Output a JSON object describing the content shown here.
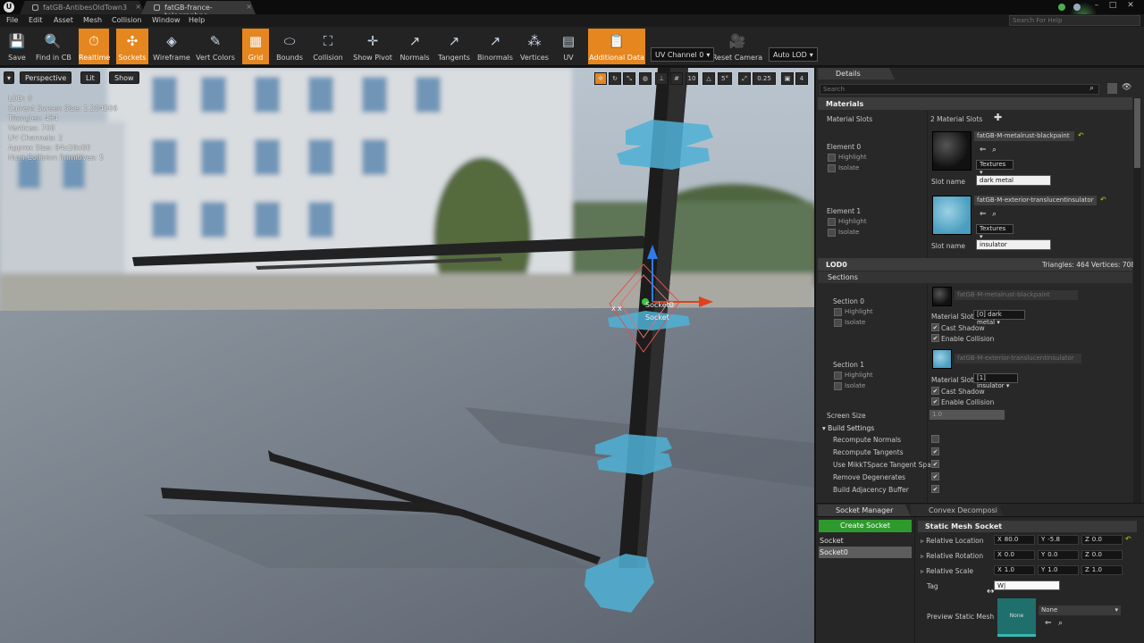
{
  "titlebar": {
    "tabs": [
      "fatGB-AntibesOldTown3",
      "fatGB-france-telegraphpo"
    ],
    "search_placeholder": "Search For Help"
  },
  "menu": [
    "File",
    "Edit",
    "Asset",
    "Mesh",
    "Collision",
    "Window",
    "Help"
  ],
  "toolbar": {
    "buttons": [
      {
        "label": "Save",
        "icon": "save-icon",
        "active": false
      },
      {
        "label": "Find in CB",
        "icon": "find-in-content-browser-icon",
        "active": false
      },
      {
        "label": "Realtime",
        "icon": "realtime-icon",
        "active": true
      },
      {
        "label": "Sockets",
        "icon": "sockets-icon",
        "active": true
      },
      {
        "label": "Wireframe",
        "icon": "wireframe-icon",
        "active": false
      },
      {
        "label": "Vert Colors",
        "icon": "vertex-colors-icon",
        "active": false
      },
      {
        "label": "Grid",
        "icon": "grid-icon",
        "active": true
      },
      {
        "label": "Bounds",
        "icon": "bounds-icon",
        "active": false
      },
      {
        "label": "Collision",
        "icon": "collision-icon",
        "active": false
      },
      {
        "label": "Show Pivot",
        "icon": "pivot-icon",
        "active": false
      },
      {
        "label": "Normals",
        "icon": "normals-icon",
        "active": false
      },
      {
        "label": "Tangents",
        "icon": "tangents-icon",
        "active": false
      },
      {
        "label": "Binormals",
        "icon": "binormals-icon",
        "active": false
      },
      {
        "label": "Vertices",
        "icon": "vertices-icon",
        "active": false
      },
      {
        "label": "UV",
        "icon": "uv-icon",
        "active": false
      },
      {
        "label": "Additional Data",
        "icon": "additional-data-icon",
        "active": true
      },
      {
        "label": "Reset Camera",
        "icon": "reset-camera-icon",
        "active": false
      }
    ],
    "uv_channel": "UV Channel 0",
    "lod": "Auto LOD"
  },
  "viewport": {
    "perspective": "Perspective",
    "lit": "Lit",
    "show": "Show",
    "stats": [
      "LOD:  0",
      "Current Screen Size:  1.204506",
      "Triangles:  464",
      "Vertices:  708",
      "UV Channels:  2",
      "Approx Size: 84x28x80",
      "Num Collision Primitives:  5"
    ],
    "snap_value": "5°",
    "scale_value": "0.25",
    "cam_speed": "4",
    "socket_labels": [
      "Socket0",
      "Socket"
    ]
  },
  "details": {
    "tab": "Details",
    "search_placeholder": "Search",
    "materials_header": "Materials",
    "material_slots_label": "Material Slots",
    "material_slots_count": "2 Material Slots",
    "highlight": "Highlight",
    "isolate": "Isolate",
    "textures": "Textures",
    "slot_name_label": "Slot name",
    "elements": [
      {
        "label": "Element 0",
        "material": "fatGB-M-metalrust-blackpaint",
        "slot_name": "dark metal"
      },
      {
        "label": "Element 1",
        "material": "fatGB-M-exterior-translucentinsulator",
        "slot_name": "insulator"
      }
    ],
    "lod_header": "LOD0",
    "lod_stats": "Triangles: 464   Vertices: 708",
    "sections_header": "Sections",
    "material_slot_label": "Material Slot",
    "cast_shadow": "Cast Shadow",
    "enable_collision": "Enable Collision",
    "sections": [
      {
        "label": "Section 0",
        "material": "fatGB-M-metalrust-blackpaint",
        "slot": "[0] dark metal"
      },
      {
        "label": "Section 1",
        "material": "fatGB-M-exterior-translucentinsulator",
        "slot": "[1] insulator"
      }
    ],
    "screen_size_label": "Screen Size",
    "screen_size_value": "1.0",
    "build_settings_header": "Build Settings",
    "build_settings": [
      {
        "label": "Recompute Normals",
        "checked": false
      },
      {
        "label": "Recompute Tangents",
        "checked": true
      },
      {
        "label": "Use MikkTSpace Tangent Spac",
        "checked": true
      },
      {
        "label": "Remove Degenerates",
        "checked": true
      },
      {
        "label": "Build Adjacency Buffer",
        "checked": true
      }
    ]
  },
  "socket_manager": {
    "tabs": [
      "Socket Manager",
      "Convex Decomposi"
    ],
    "create_button": "Create Socket",
    "sockets": [
      "Socket",
      "Socket0"
    ],
    "selected_socket": "Socket0",
    "header": "Static Mesh Socket",
    "relative_location": {
      "label": "Relative Location",
      "x": "80.0",
      "y": "-5.8",
      "z": "0.0"
    },
    "relative_rotation": {
      "label": "Relative Rotation",
      "x": "0.0",
      "y": "0.0",
      "z": "0.0"
    },
    "relative_scale": {
      "label": "Relative Scale",
      "x": "1.0",
      "y": "1.0",
      "z": "1.0"
    },
    "tag_label": "Tag",
    "tag_value": "W|",
    "preview_label": "Preview Static Mesh",
    "preview_thumb_text": "None",
    "preview_value": "None"
  },
  "colors": {
    "accent_orange": "#e5861f",
    "create_socket_green": "#2e9a2e",
    "panel_bg": "#282828"
  }
}
